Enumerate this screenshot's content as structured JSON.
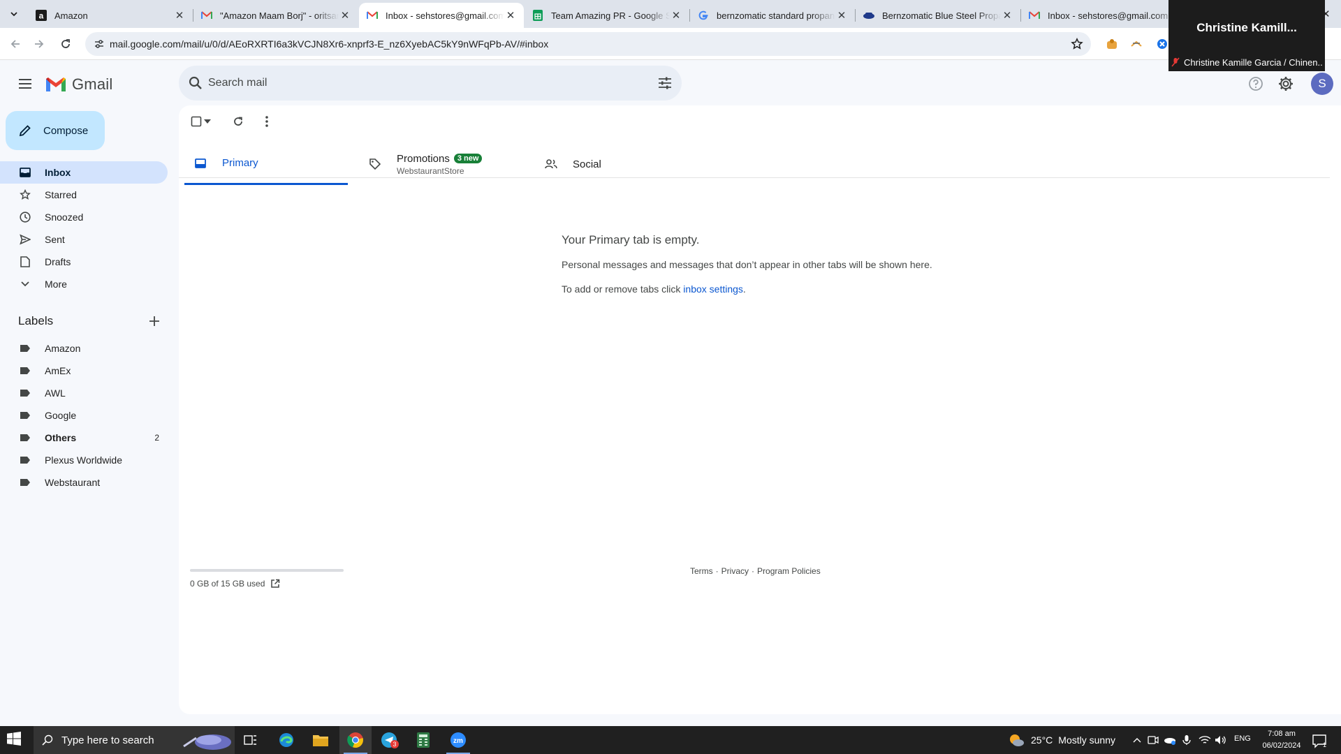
{
  "browser": {
    "tabs": [
      {
        "title": "Amazon",
        "icon": "amazon-icon"
      },
      {
        "title": "\"Amazon Maam Borj\" - oritsara",
        "icon": "gmail-icon"
      },
      {
        "title": "Inbox - sehstores@gmail.com - ",
        "icon": "gmail-icon",
        "active": true
      },
      {
        "title": "Team Amazing PR - Google She",
        "icon": "sheets-icon"
      },
      {
        "title": "bernzomatic standard propane",
        "icon": "google-icon"
      },
      {
        "title": "Bernzomatic Blue Steel Propan",
        "icon": "bernzomatic-icon"
      },
      {
        "title": "Inbox - sehstores@gmail.com - ",
        "icon": "gmail-icon"
      }
    ],
    "url": "mail.google.com/mail/u/0/d/AEoRXRTI6a3kVCJN8Xr6-xnprf3-E_nz6XyebAC5kY9nWFqPb-AV/#inbox"
  },
  "zoom_overlay": {
    "name": "Christine  Kamill...",
    "subtitle": "Christine Kamille Garcia / Chinen..."
  },
  "gmail": {
    "logo_text": "Gmail",
    "search_placeholder": "Search mail",
    "avatar_initial": "S",
    "compose_label": "Compose",
    "nav": [
      {
        "label": "Inbox",
        "icon": "inbox-icon",
        "selected": true
      },
      {
        "label": "Starred",
        "icon": "star-icon"
      },
      {
        "label": "Snoozed",
        "icon": "clock-icon"
      },
      {
        "label": "Sent",
        "icon": "send-icon"
      },
      {
        "label": "Drafts",
        "icon": "draft-icon"
      },
      {
        "label": "More",
        "icon": "chevron-down-icon"
      }
    ],
    "labels_heading": "Labels",
    "labels": [
      {
        "label": "Amazon",
        "count": ""
      },
      {
        "label": "AmEx",
        "count": ""
      },
      {
        "label": "AWL",
        "count": ""
      },
      {
        "label": "Google",
        "count": ""
      },
      {
        "label": "Others",
        "count": "2",
        "bold": true
      },
      {
        "label": "Plexus Worldwide",
        "count": ""
      },
      {
        "label": "Webstaurant",
        "count": ""
      }
    ],
    "category_tabs": {
      "primary": "Primary",
      "promotions": "Promotions",
      "promotions_badge": "3 new",
      "promotions_sender": "WebstaurantStore",
      "social": "Social"
    },
    "empty_state": {
      "title": "Your Primary tab is empty.",
      "body": "Personal messages and messages that don’t appear in other tabs will be shown here.",
      "settings_prefix": "To add or remove tabs click ",
      "settings_link": "inbox settings",
      "settings_suffix": "."
    },
    "storage": {
      "text": "0 GB of 15 GB used",
      "fraction_used": 0.0
    },
    "footer": {
      "terms": "Terms",
      "sep": "·",
      "privacy": "Privacy",
      "policies": "Program Policies"
    }
  },
  "taskbar": {
    "search_placeholder": "Type here to search",
    "weather": {
      "temp": "25°C",
      "condition": "Mostly sunny"
    },
    "lang": "ENG",
    "time": "7:08 am",
    "date": "06/02/2024",
    "telegram_badge": "3",
    "notification_count": "1"
  },
  "colors": {
    "accent": "#0b57d0",
    "compose_bg": "#c2e7ff",
    "selected_nav": "#d3e3fd",
    "promo_badge": "#188038",
    "gmail_red": "#ea4335"
  }
}
